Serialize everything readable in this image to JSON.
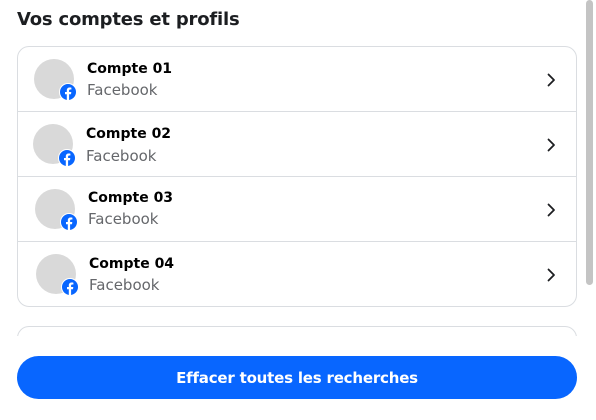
{
  "section": {
    "title": "Vos comptes et profils"
  },
  "accounts": [
    {
      "name": "Compte 01",
      "platform": "Facebook"
    },
    {
      "name": "Compte 02",
      "platform": "Facebook"
    },
    {
      "name": "Compte 03",
      "platform": "Facebook"
    },
    {
      "name": "Compte 04",
      "platform": "Facebook"
    }
  ],
  "icons": {
    "badge": "facebook-icon",
    "row_action": "chevron-right-icon"
  },
  "actions": {
    "clear_label": "Effacer toutes les recherches"
  },
  "colors": {
    "accent": "#0866ff",
    "facebook_blue": "#0866ff",
    "avatar_placeholder": "#d9d9d9",
    "secondary_text": "#65676b"
  }
}
